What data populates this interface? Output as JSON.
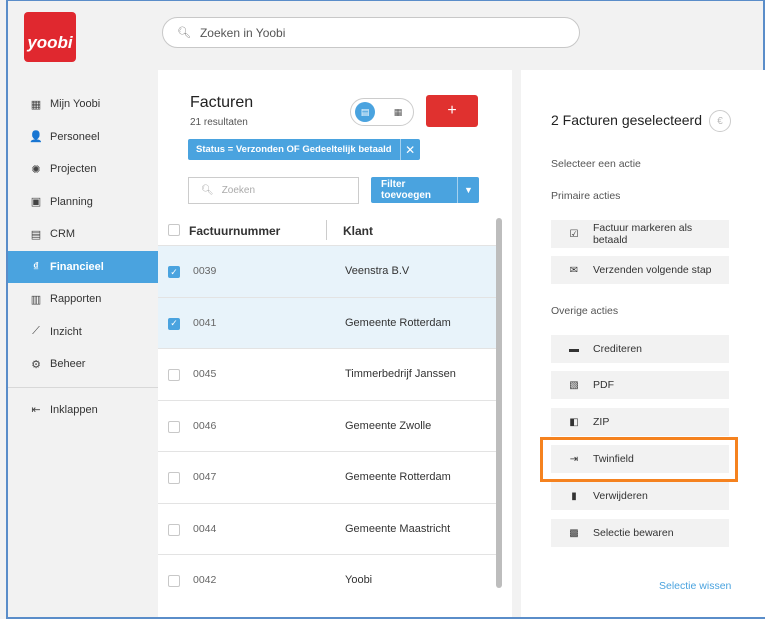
{
  "logo": {
    "text": "yoobi"
  },
  "search": {
    "placeholder": "Zoeken in Yoobi",
    "icon": "search-icon"
  },
  "sidebar": {
    "items": [
      {
        "label": "Mijn Yoobi",
        "icon": "dashboard-icon",
        "glyph": "▦"
      },
      {
        "label": "Personeel",
        "icon": "person-icon",
        "glyph": "👤"
      },
      {
        "label": "Projecten",
        "icon": "lightbulb-icon",
        "glyph": "✺"
      },
      {
        "label": "Planning",
        "icon": "calendar-icon",
        "glyph": "▣"
      },
      {
        "label": "CRM",
        "icon": "crm-icon",
        "glyph": "▤"
      },
      {
        "label": "Financieel",
        "icon": "finance-icon",
        "glyph": "₫"
      },
      {
        "label": "Rapporten",
        "icon": "bar-chart-icon",
        "glyph": "▥"
      },
      {
        "label": "Inzicht",
        "icon": "line-chart-icon",
        "glyph": "⟋"
      },
      {
        "label": "Beheer",
        "icon": "gear-icon",
        "glyph": "⚙"
      }
    ],
    "active_index": 5,
    "collapse": {
      "label": "Inklappen",
      "icon": "collapse-icon",
      "glyph": "⇤"
    }
  },
  "list": {
    "title": "Facturen",
    "count": "21 resultaten",
    "add_label": "+",
    "filter_chip": "Status = Verzonden OF Gedeeltelijk betaald",
    "chip_close": "✕",
    "search_placeholder": "Zoeken",
    "filter_button": "Filter toevoegen",
    "columns": {
      "number": "Factuurnummer",
      "client": "Klant"
    },
    "rows": [
      {
        "number": "0039",
        "client": "Veenstra B.V",
        "checked": true
      },
      {
        "number": "0041",
        "client": "Gemeente Rotterdam",
        "checked": true
      },
      {
        "number": "0045",
        "client": "Timmerbedrijf Janssen",
        "checked": false
      },
      {
        "number": "0046",
        "client": "Gemeente Zwolle",
        "checked": false
      },
      {
        "number": "0047",
        "client": "Gemeente Rotterdam",
        "checked": false
      },
      {
        "number": "0044",
        "client": "Gemeente Maastricht",
        "checked": false
      },
      {
        "number": "0042",
        "client": "Yoobi",
        "checked": false
      }
    ]
  },
  "actions": {
    "title": "2 Facturen geselecteerd",
    "euro": "€",
    "choose_label": "Selecteer een actie",
    "primary_label": "Primaire acties",
    "primary": [
      {
        "label": "Factuur markeren als betaald",
        "icon": "checkbox-icon",
        "glyph": "☑"
      },
      {
        "label": "Verzenden volgende stap",
        "icon": "mail-icon",
        "glyph": "✉"
      }
    ],
    "other_label": "Overige acties",
    "other": [
      {
        "label": "Crediteren",
        "icon": "credit-card-icon",
        "glyph": "▬"
      },
      {
        "label": "PDF",
        "icon": "pdf-icon",
        "glyph": "▧"
      },
      {
        "label": "ZIP",
        "icon": "zip-icon",
        "glyph": "◧"
      },
      {
        "label": "Twinfield",
        "icon": "export-icon",
        "glyph": "⇥"
      },
      {
        "label": "Verwijderen",
        "icon": "trash-icon",
        "glyph": "▮"
      },
      {
        "label": "Selectie bewaren",
        "icon": "save-icon",
        "glyph": "▩"
      }
    ],
    "clear_link": "Selectie wissen"
  },
  "colors": {
    "accent": "#4aa3df",
    "brand": "#e0282f",
    "highlight": "#f5821f"
  }
}
